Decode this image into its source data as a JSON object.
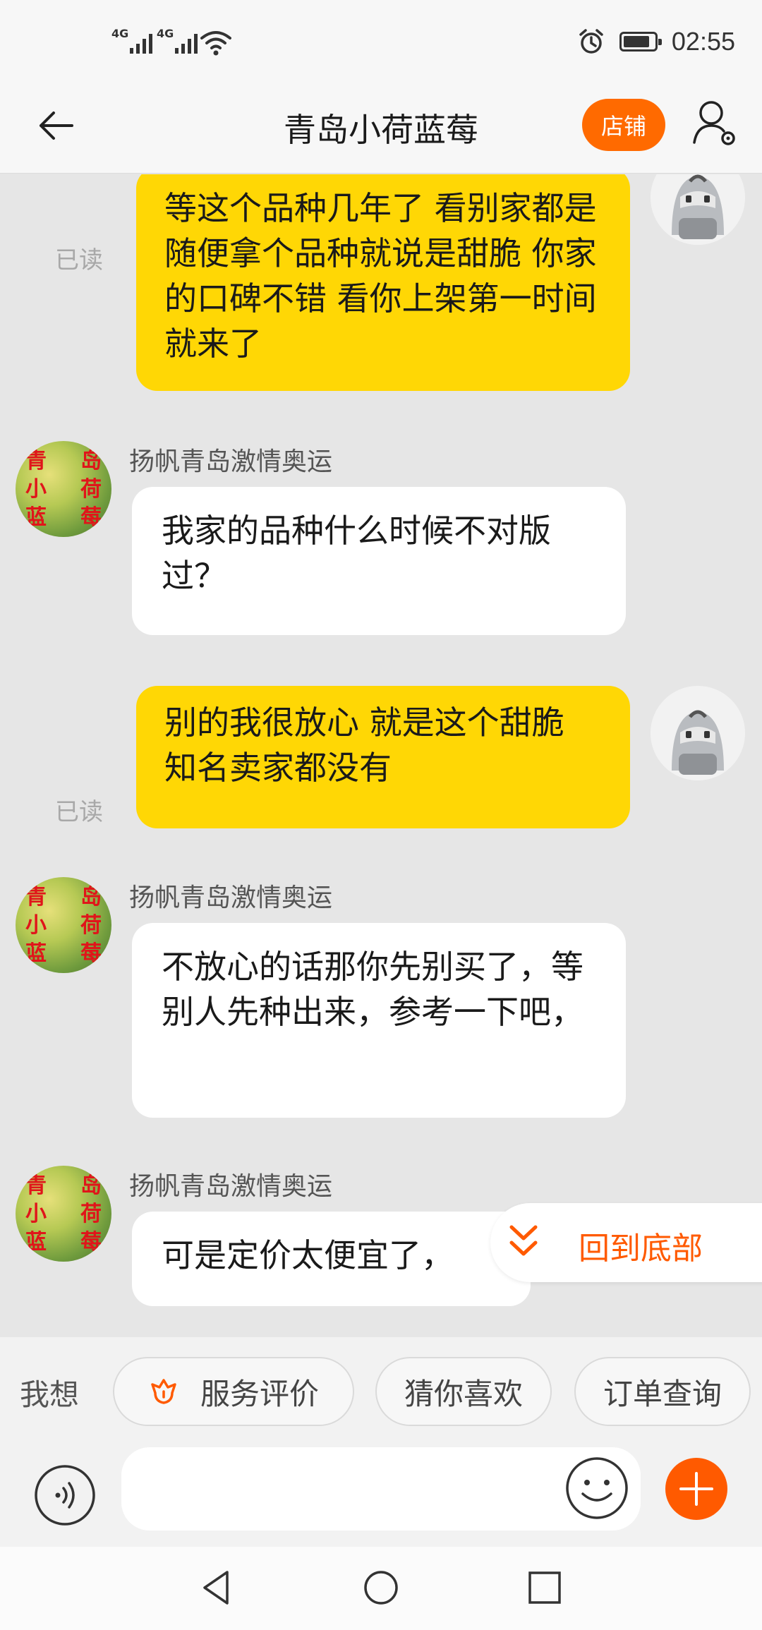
{
  "status_bar": {
    "signal_1": "4G",
    "signal_2": "4G",
    "wifi_icon": "wifi-icon",
    "alarm_icon": "alarm-icon",
    "battery_level": 0.85,
    "time": "02:55"
  },
  "header": {
    "back_icon": "back-arrow-icon",
    "title": "青岛小荷蓝莓",
    "store_label": "店铺",
    "profile_icon": "user-settings-icon"
  },
  "messages": [
    {
      "side": "out",
      "text": "等这个品种几年了 看别家都是随便拿个品种就说是甜脆 你家的口碑不错 看你上架第一时间就来了",
      "status": "已读"
    },
    {
      "side": "in",
      "sender": "扬帆青岛激情奥运",
      "text": "我家的品种什么时候不对版过？"
    },
    {
      "side": "out",
      "text": "别的我很放心 就是这个甜脆 知名卖家都没有",
      "status": "已读"
    },
    {
      "side": "in",
      "sender": "扬帆青岛激情奥运",
      "text": "不放心的话那你先别买了，等别人先种出来，参考一下吧，"
    },
    {
      "side": "in",
      "sender": "扬帆青岛激情奥运",
      "text": "可是定价太便宜了，"
    }
  ],
  "shop_avatar_chars": [
    "青",
    "岛",
    "小",
    "荷",
    "蓝",
    "莓"
  ],
  "back_to_bottom": {
    "label": "回到底部",
    "icon": "double-chevron-down-icon"
  },
  "quick_replies": {
    "prefix": "我想",
    "items": [
      {
        "label": "服务评价",
        "icon": "flower-icon"
      },
      {
        "label": "猜你喜欢"
      },
      {
        "label": "订单查询"
      }
    ]
  },
  "input_bar": {
    "voice_icon": "voice-icon",
    "placeholder": "",
    "emoji_icon": "emoji-icon",
    "plus_icon": "plus-icon"
  },
  "nav_bar": {
    "back_icon": "nav-back-icon",
    "home_icon": "nav-home-icon",
    "recents_icon": "nav-recents-icon"
  },
  "colors": {
    "accent": "#ff5a00",
    "store_button": "#ff6a00",
    "outgoing_bubble": "#ffd705",
    "incoming_bubble": "#ffffff",
    "chat_background": "#e6e6e6",
    "read_receipt": "#a8a8a8"
  }
}
